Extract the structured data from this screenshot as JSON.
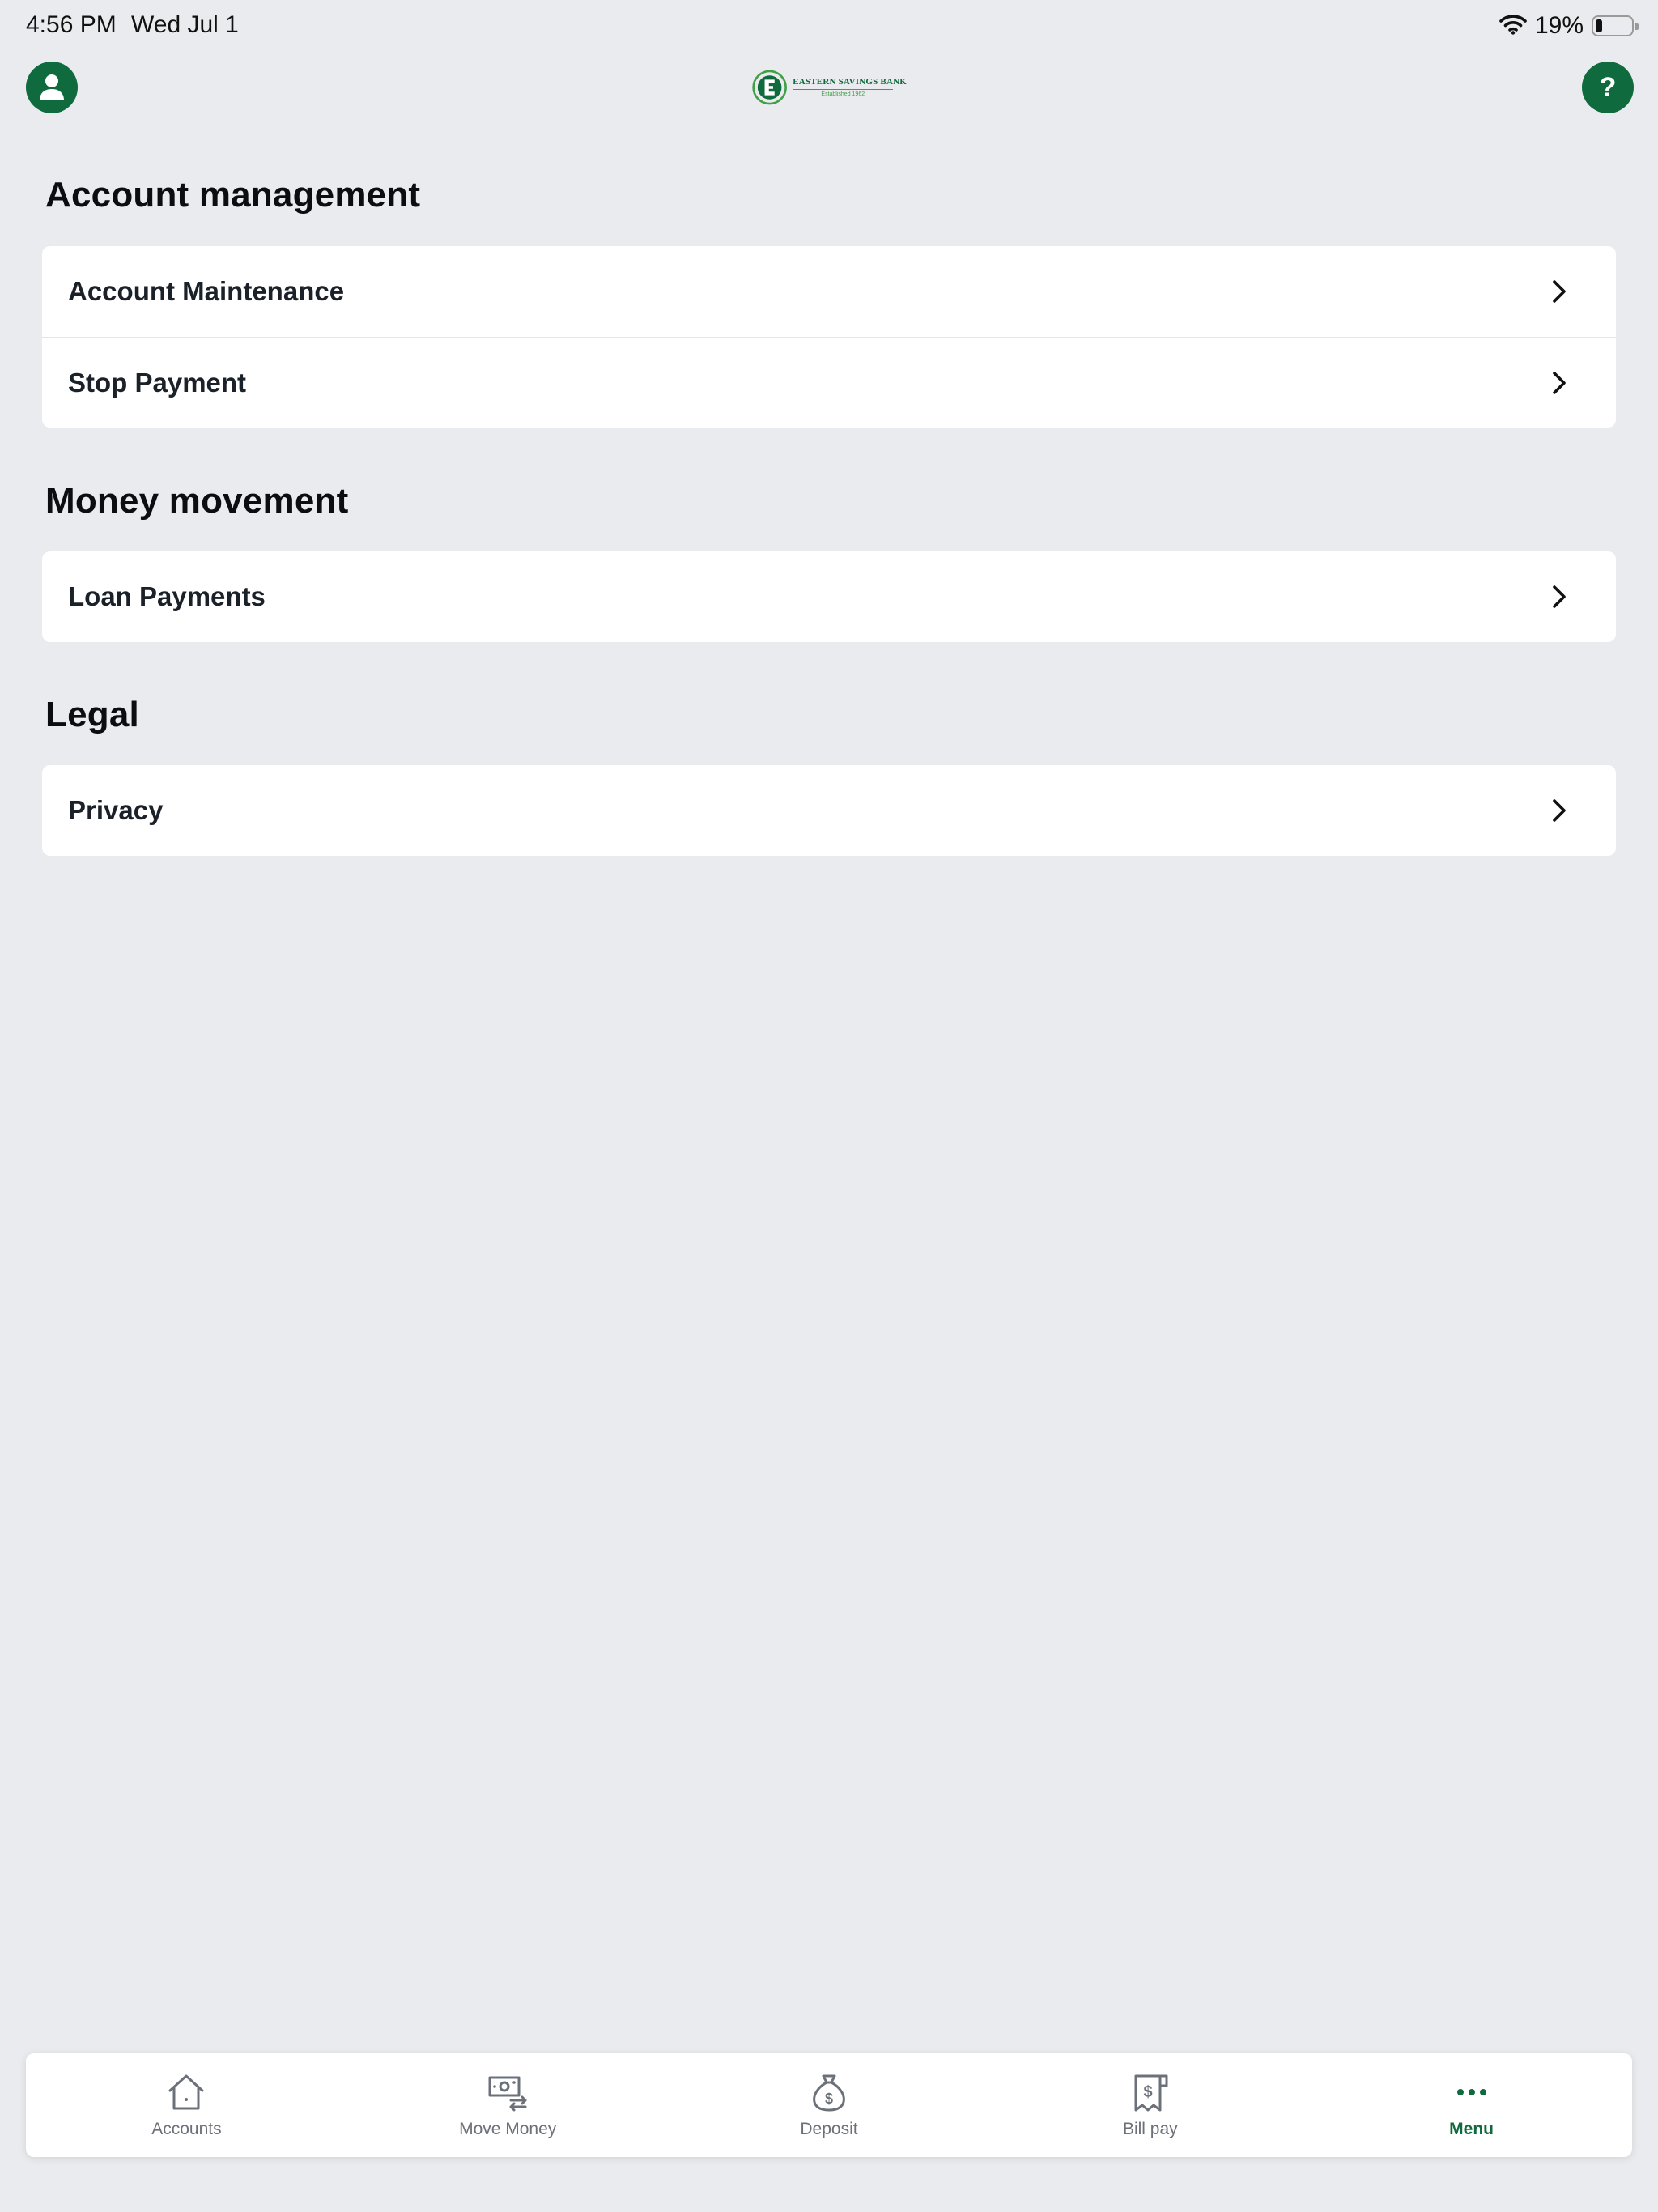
{
  "status_bar": {
    "time": "4:56 PM",
    "date": "Wed Jul 1",
    "battery_percent": "19%",
    "battery_level": 0.19,
    "wifi_icon": "wifi-icon"
  },
  "header": {
    "profile_icon": "user-icon",
    "help_icon": "help-icon",
    "logo": {
      "name": "EASTERN SAVINGS BANK",
      "tagline": "Established 1962"
    }
  },
  "colors": {
    "brand_green": "#0f6a3e",
    "background": "#eaebee",
    "card": "#ffffff"
  },
  "sections": [
    {
      "title": "Account management",
      "items": [
        {
          "label": "Account Maintenance"
        },
        {
          "label": "Stop Payment"
        }
      ]
    },
    {
      "title": "Money movement",
      "items": [
        {
          "label": "Loan Payments"
        }
      ]
    },
    {
      "title": "Legal",
      "items": [
        {
          "label": "Privacy"
        }
      ]
    }
  ],
  "tab_bar": {
    "tabs": [
      {
        "label": "Accounts",
        "icon": "home-icon",
        "active": false
      },
      {
        "label": "Move Money",
        "icon": "transfer-icon",
        "active": false
      },
      {
        "label": "Deposit",
        "icon": "money-bag-icon",
        "active": false
      },
      {
        "label": "Bill pay",
        "icon": "bill-icon",
        "active": false
      },
      {
        "label": "Menu",
        "icon": "more-icon",
        "active": true
      }
    ]
  }
}
